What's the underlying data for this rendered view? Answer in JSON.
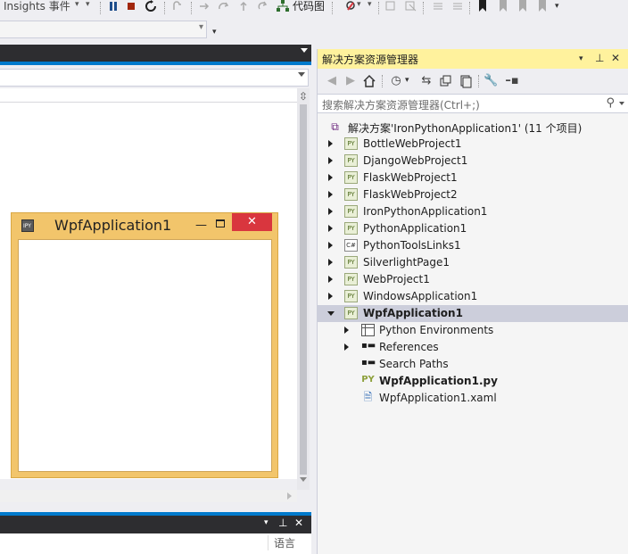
{
  "toolbar": {
    "insights_label": "Insights 事件",
    "codemap_label": "代码图"
  },
  "colors": {
    "accent": "#007ACC",
    "panel_header_active": "#FFF29D",
    "selection": "#CCCEDB",
    "wpf_frame": "#F2C56B",
    "wpf_close": "#D9363E"
  },
  "wpf_window": {
    "title": "WpfApplication1",
    "close_glyph": "✕",
    "minimize_glyph": "—"
  },
  "bottom_panel": {
    "column_label": "语言"
  },
  "solution_explorer": {
    "title": "解决方案资源管理器",
    "search_placeholder": "搜索解决方案资源管理器(Ctrl+;)",
    "solution_label": "解决方案'IronPythonApplication1' (11 个项目)",
    "projects": [
      {
        "label": "BottleWebProject1",
        "icon": "py"
      },
      {
        "label": "DjangoWebProject1",
        "icon": "py"
      },
      {
        "label": "FlaskWebProject1",
        "icon": "py"
      },
      {
        "label": "FlaskWebProject2",
        "icon": "py"
      },
      {
        "label": "IronPythonApplication1",
        "icon": "py"
      },
      {
        "label": "PythonApplication1",
        "icon": "py"
      },
      {
        "label": "PythonToolsLinks1",
        "icon": "cs"
      },
      {
        "label": "SilverlightPage1",
        "icon": "py"
      },
      {
        "label": "WebProject1",
        "icon": "py"
      },
      {
        "label": "WindowsApplication1",
        "icon": "py"
      }
    ],
    "selected_project": {
      "label": "WpfApplication1",
      "children": [
        {
          "label": "Python Environments",
          "icon": "environments-icon"
        },
        {
          "label": "References",
          "icon": "references-icon"
        },
        {
          "label": "Search Paths",
          "icon": "search-paths-icon"
        },
        {
          "label": "WpfApplication1.py",
          "icon": "python-file-icon"
        },
        {
          "label": "WpfApplication1.xaml",
          "icon": "xaml-file-icon"
        }
      ]
    }
  }
}
